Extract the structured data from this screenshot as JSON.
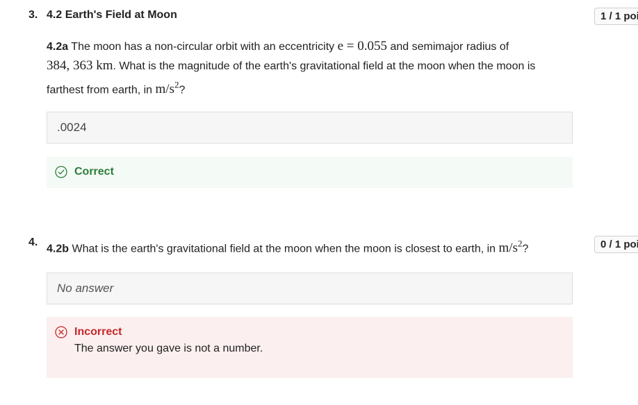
{
  "questions": [
    {
      "number": "3.",
      "title": "4.2 Earth's Field at Moon",
      "points": "1 / 1 poi",
      "part_label": "4.2a",
      "prompt_1": "The moon has a non-circular orbit with an eccentricity",
      "math_e": "e = 0.055",
      "prompt_2": "and semimajor radius of",
      "math_r": "384, 363 km",
      "prompt_3": ". What is the magnitude of the earth's gravitational field at the moon when the moon is",
      "prompt_4": "farthest from earth, in",
      "unit": "m/s",
      "unit_exp": "2",
      "prompt_end": "?",
      "answer_value": ".0024",
      "feedback_status": "Correct",
      "feedback_message": ""
    },
    {
      "number": "4.",
      "title": "",
      "points": "0 / 1 poi",
      "part_label": "4.2b",
      "prompt_1": "What is the earth's gravitational field at the moon when the moon is closest to earth, in",
      "unit": "m/s",
      "unit_exp": "2",
      "prompt_end": "?",
      "answer_value": "No answer",
      "feedback_status": "Incorrect",
      "feedback_message": "The answer you gave is not a number."
    }
  ],
  "colors": {
    "correct": "#2e7d3b",
    "incorrect": "#c62828",
    "correct_bg": "#f4faf5",
    "incorrect_bg": "#fbefef"
  },
  "icons": {
    "correct": "check-circle-icon",
    "incorrect": "x-circle-icon"
  }
}
